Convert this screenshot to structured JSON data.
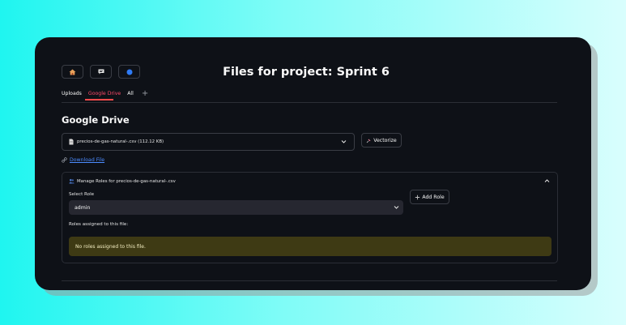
{
  "toolbar": {
    "home_icon": "home-icon",
    "chat_icon": "chat-bubble-icon",
    "status_icon": "blue-circle-icon"
  },
  "page": {
    "title": "Files for project: Sprint 6"
  },
  "tabs": [
    {
      "label": "Uploads",
      "active": false
    },
    {
      "label": "Google Drive",
      "active": true
    },
    {
      "label": "All",
      "active": false
    }
  ],
  "section": {
    "heading": "Google Drive"
  },
  "file_select": {
    "value": "precios-de-gas-natural-.csv (112.12 KB)"
  },
  "vectorize": {
    "label": "Vectorize"
  },
  "download": {
    "label": "Download File"
  },
  "expander": {
    "header": "Manage Roles for precios-de-gas-natural-.csv",
    "select_label": "Select Role",
    "selected_role": "admin",
    "add_role_label": "Add Role",
    "assigned_label": "Roles assigned to this file:",
    "warning": "No roles assigned to this file."
  },
  "colors": {
    "accent": "#ff4b4b",
    "link": "#4c8cff",
    "background": "#0e1117",
    "warning_bg": "#3e3a14"
  }
}
